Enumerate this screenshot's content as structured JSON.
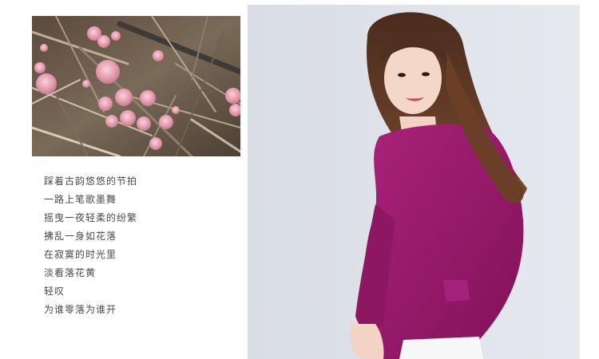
{
  "poem": {
    "lines": [
      "踩着古韵悠悠的节拍",
      "一路上笔歌墨舞",
      "摇曳一夜轻柔的纷繁",
      "拂乱一身如花落",
      "在寂寞的时光里",
      "淡看落花黄",
      "轻叹",
      "为谁零落为谁开"
    ]
  },
  "colors": {
    "sweater": "#9b1b6e",
    "mushroom": "#e8a4b4",
    "background_right": "#dfe3e9",
    "text": "#4a4a4a"
  }
}
